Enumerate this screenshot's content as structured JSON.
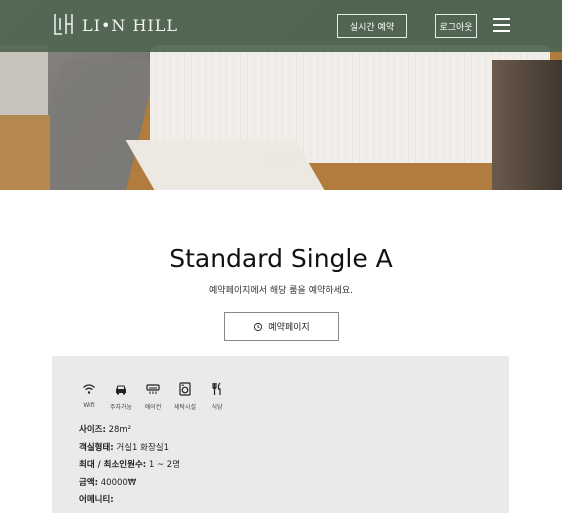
{
  "header": {
    "logo_text": "LI•N HILL",
    "realtime_button": "실시간 예약",
    "logout_button": "로그아웃"
  },
  "room": {
    "title": "Standard Single A",
    "subtitle": "예약페이지에서 해당 룸을 예약하세요.",
    "reserve_button": "예약페이지"
  },
  "amenities": [
    {
      "icon": "wifi-icon",
      "label": "Wifi"
    },
    {
      "icon": "car-icon",
      "label": "주차가능"
    },
    {
      "icon": "air-conditioner-icon",
      "label": "에어컨"
    },
    {
      "icon": "washing-machine-icon",
      "label": "세탁시설"
    },
    {
      "icon": "restaurant-icon",
      "label": "식당"
    }
  ],
  "details": {
    "size_key": "사이즈:",
    "size_val": "28m²",
    "type_key": "객실형태:",
    "type_val": "거실1 화장실1",
    "capacity_key": "최대 / 최소인원수:",
    "capacity_val": "1 ~ 2명",
    "price_key": "금액:",
    "price_val": "40000₩",
    "amenity_key": "어메니티:"
  },
  "colors": {
    "header_bg": "#4e6650",
    "panel_bg": "#e9ebe9"
  }
}
